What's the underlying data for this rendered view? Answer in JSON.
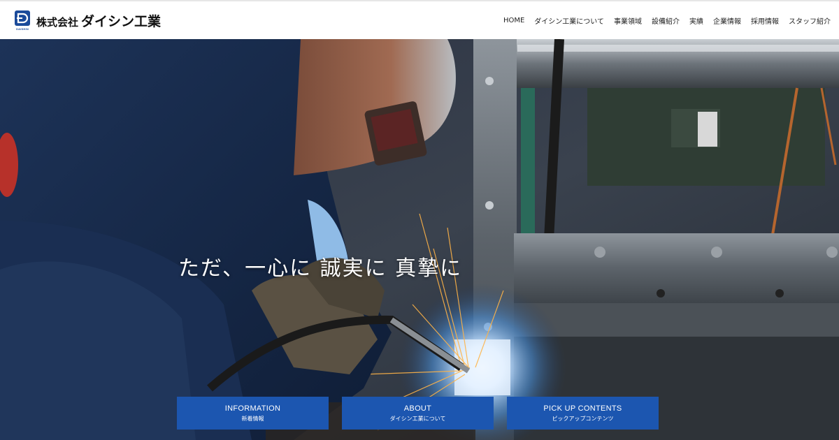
{
  "header": {
    "logo_sub": "DAISHIN",
    "company_prefix": "株式会社",
    "company_name": "ダイシン工業",
    "nav": [
      {
        "label": "HOME"
      },
      {
        "label": "ダイシン工業について"
      },
      {
        "label": "事業領域"
      },
      {
        "label": "設備紹介"
      },
      {
        "label": "実績"
      },
      {
        "label": "企業情報"
      },
      {
        "label": "採用情報"
      },
      {
        "label": "スタッフ紹介"
      }
    ]
  },
  "hero": {
    "tagline": "ただ、一心に 誠実に 真摯に",
    "cards": [
      {
        "title": "INFORMATION",
        "sub": "新着情報"
      },
      {
        "title": "ABOUT",
        "sub": "ダイシン工業について"
      },
      {
        "title": "PICK UP CONTENTS",
        "sub": "ピックアップコンテンツ"
      }
    ]
  },
  "colors": {
    "brand_blue": "#1c56b0",
    "logo_blue": "#1a4a9a"
  },
  "icons": {
    "logo": "daishin-logo-icon"
  }
}
